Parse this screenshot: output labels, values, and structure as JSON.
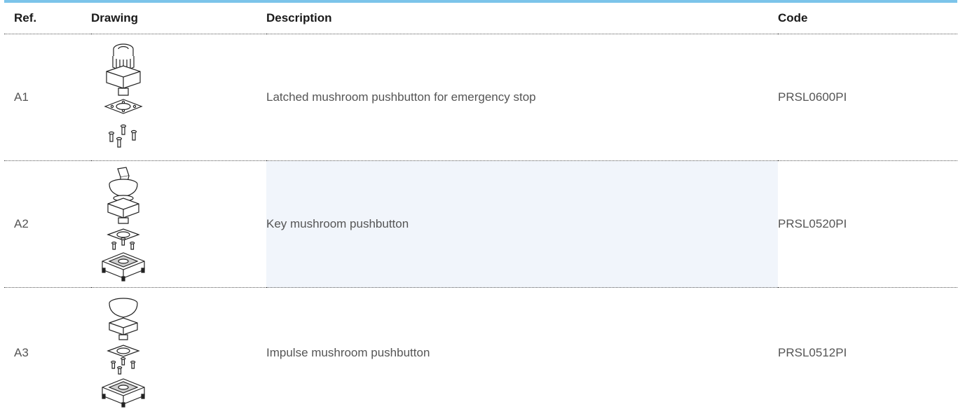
{
  "table": {
    "headers": {
      "ref": "Ref.",
      "drawing": "Drawing",
      "description": "Description",
      "code": "Code"
    },
    "rows": [
      {
        "ref": "A1",
        "drawing_icon": "latched-mushroom-pushbutton-drawing",
        "description": "Latched mushroom pushbutton for emergency stop",
        "code": "PRSL0600PI"
      },
      {
        "ref": "A2",
        "drawing_icon": "key-mushroom-pushbutton-drawing",
        "description": "Key mushroom pushbutton",
        "code": "PRSL0520PI"
      },
      {
        "ref": "A3",
        "drawing_icon": "impulse-mushroom-pushbutton-drawing",
        "description": "Impulse mushroom pushbutton",
        "code": "PRSL0512PI"
      }
    ]
  },
  "colors": {
    "accent_rule": "#7cc4ea",
    "highlight_cell": "#f1f5fb",
    "text": "#555555",
    "header_text": "#1a1a1a"
  }
}
